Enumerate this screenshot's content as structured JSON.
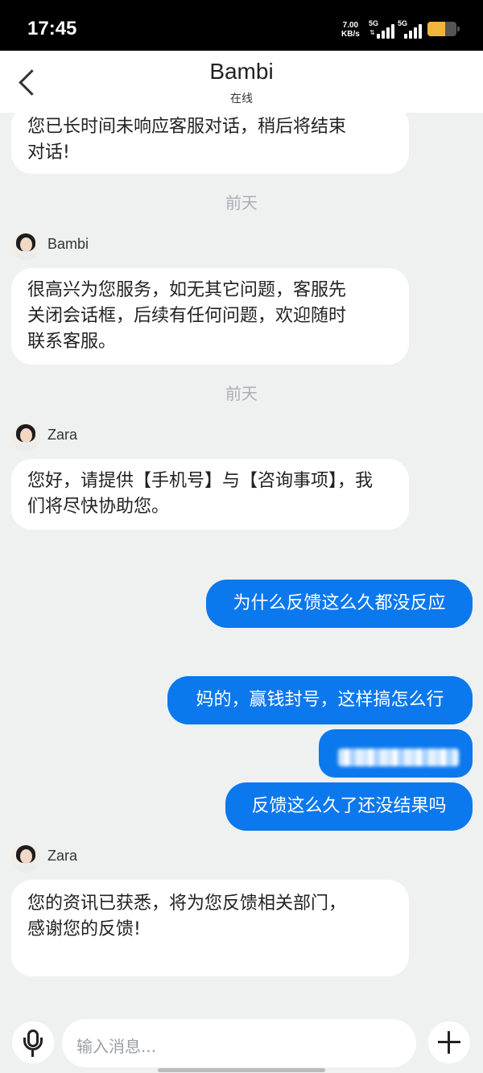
{
  "status_bar": {
    "time": "17:45",
    "net_speed_value": "7.00",
    "net_speed_unit": "KB/s",
    "sim1_label": "5G",
    "sim2_label": "5G",
    "battery_level": 0.6,
    "battery_color": "#f2b53c"
  },
  "header": {
    "title": "Bambi",
    "subtitle": "在线"
  },
  "messages": [
    {
      "type": "incoming",
      "text": "您已长时间未响应客服对话，稍后将结束对话!"
    },
    {
      "type": "date",
      "text": "前天"
    },
    {
      "type": "agent",
      "name": "Bambi"
    },
    {
      "type": "incoming",
      "text": "很高兴为您服务，如无其它问题，客服先关闭会话框，后续有任何问题，欢迎随时联系客服。"
    },
    {
      "type": "date",
      "text": "前天"
    },
    {
      "type": "agent",
      "name": "Zara"
    },
    {
      "type": "incoming",
      "text": "您好，请提供【手机号】与【咨询事项】，我们将尽快协助您。"
    },
    {
      "type": "outgoing",
      "text": "为什么反馈这么久都没反应"
    },
    {
      "type": "outgoing",
      "text": "妈的，赢钱封号，这样搞怎么行"
    },
    {
      "type": "outgoing_redacted"
    },
    {
      "type": "outgoing",
      "text": "反馈这么久了还没结果吗"
    },
    {
      "type": "agent",
      "name": "Zara"
    },
    {
      "type": "incoming",
      "text": "您的资讯已获悉，将为您反馈相关部门，感谢您的反馈!"
    }
  ],
  "msg_lines": {
    "m0": [
      "您已长时间未响应客服对话，稍后将结束",
      "对话!"
    ],
    "m3": [
      "很高兴为您服务，如无其它问题，客服先",
      "关闭会话框，后续有任何问题，欢迎随时",
      "联系客服。"
    ],
    "m6": [
      "您好，请提供【手机号】与【咨询事项】，我",
      "们将尽快协助您。"
    ],
    "m12": [
      "您的资讯已获悉，将为您反馈相关部门，",
      "感谢您的反馈!"
    ]
  },
  "input_bar": {
    "placeholder": "输入消息...",
    "icons": [
      "microphone-icon",
      "emoji-icon",
      "plus-icon"
    ]
  },
  "colors": {
    "outgoing_bubble": "#0b78ee",
    "background": "#eff1f1",
    "date_text": "#a8b0b6"
  }
}
